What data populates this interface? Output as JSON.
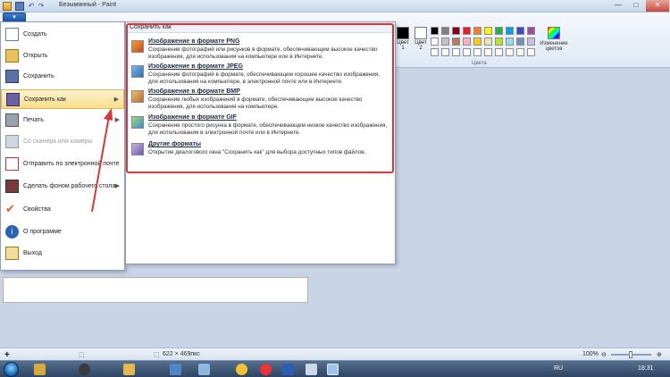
{
  "window": {
    "title": "Безымянный - Paint",
    "controls": {
      "minimize": "—",
      "maximize": "□",
      "close": "✕"
    }
  },
  "ribbon": {
    "file_button": "▾",
    "color1_label": "Цвет 1",
    "color2_label": "Цвет 2",
    "palette_group_label": "Цвета",
    "edit_colors_label": "Изменение цветов",
    "swatches": [
      "#000000",
      "#7f7f7f",
      "#880015",
      "#ed1c24",
      "#ff7f27",
      "#fff200",
      "#22b14c",
      "#00a2e8",
      "#3f48cc",
      "#a349a4",
      "#ffffff",
      "#c3c3c3",
      "#b97a57",
      "#ffaec9",
      "#ffc90e",
      "#efe4b0",
      "#b5e61d",
      "#99d9ea",
      "#7092be",
      "#c8bfe7"
    ]
  },
  "file_menu": {
    "items": [
      {
        "label": "Создать",
        "icon": "new-document-icon"
      },
      {
        "label": "Открыть",
        "icon": "open-folder-icon"
      },
      {
        "label": "Сохранить",
        "icon": "save-icon"
      },
      {
        "label": "Сохранить как",
        "icon": "save-as-icon",
        "has_submenu": true,
        "active": true
      },
      {
        "label": "Печать",
        "icon": "print-icon",
        "has_submenu": true
      },
      {
        "label": "Со сканера или камеры",
        "icon": "scanner-icon",
        "disabled": true
      },
      {
        "label": "Отправить по электронной почте",
        "icon": "email-icon"
      },
      {
        "label": "Сделать фоном рабочего стола",
        "icon": "desktop-background-icon",
        "has_submenu": true
      },
      {
        "label": "Свойства",
        "icon": "properties-check-icon"
      },
      {
        "label": "О программе",
        "icon": "info-icon"
      },
      {
        "label": "Выход",
        "icon": "exit-icon"
      }
    ],
    "arrow_glyph": "▶"
  },
  "save_as_submenu": {
    "header": "Сохранить как",
    "formats": [
      {
        "name": "Изображение в формате PNG",
        "description": "Сохранение фотографий или рисунков в формате, обеспечивающем высокое качество изображения, для использования на компьютере или в Интернете.",
        "icon": "png-image-icon"
      },
      {
        "name": "Изображение в формате JPEG",
        "description": "Сохранение фотографий в формате, обеспечивающем хорошее качество изображения, для использования на компьютере, в электронной почте или в Интернете.",
        "icon": "jpeg-image-icon"
      },
      {
        "name": "Изображение в формате BMP",
        "description": "Сохранение любых изображений в формате, обеспечивающем высокое качество изображения, для использования на компьютере.",
        "icon": "bmp-image-icon"
      },
      {
        "name": "Изображение в формате GIF",
        "description": "Сохранение простого рисунка в формате, обеспечивающем низкое качество изображения, для использования в электронной почте или в Интернете.",
        "icon": "gif-image-icon"
      },
      {
        "name": "Другие форматы",
        "description": "Открытие диалогового окна \"Сохранить как\" для выбора доступных типов файлов.",
        "icon": "other-formats-icon"
      }
    ]
  },
  "statusbar": {
    "move_icon": "✚",
    "select_icon": "⬚",
    "image_size": "622 × 469пкс",
    "zoom": "100%",
    "zoom_minus": "⊖",
    "zoom_plus": "⊕"
  },
  "taskbar": {
    "language": "RU",
    "clock": "18:31"
  }
}
